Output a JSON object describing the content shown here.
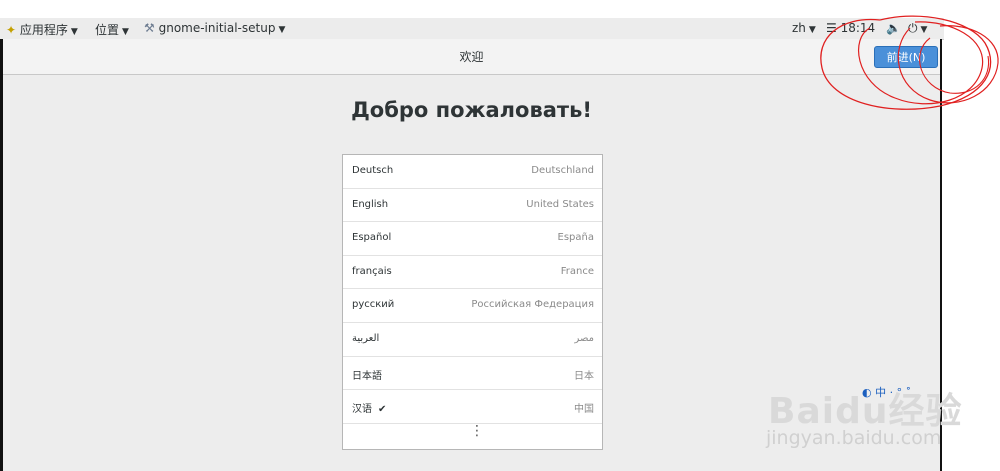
{
  "topbar": {
    "apps_menu": "应用程序",
    "places_menu": "位置",
    "active_app": "gnome-initial-setup",
    "input_method": "zh",
    "clock": "18:14"
  },
  "headerbar": {
    "title": "欢迎",
    "next_button": "前进(N)"
  },
  "main": {
    "heading": "Добро пожаловать!",
    "languages": [
      {
        "name": "Deutsch",
        "region": "Deutschland"
      },
      {
        "name": "English",
        "region": "United States"
      },
      {
        "name": "Español",
        "region": "España"
      },
      {
        "name": "français",
        "region": "France"
      },
      {
        "name": "русский",
        "region": "Российская Федерация"
      },
      {
        "name": "العربية",
        "region": "مصر"
      },
      {
        "name": "日本語",
        "region": "日本"
      },
      {
        "name": "汉语",
        "region": "中国",
        "selected": true
      }
    ],
    "more_icon": "⋮"
  },
  "watermark": {
    "logo": "Baidu经验",
    "url": "jingyan.baidu.com",
    "ime_text": "中"
  },
  "colors": {
    "accent": "#4a90d9",
    "annotation": "#e02020"
  },
  "icons": [
    "apps-icon",
    "settings-app-icon",
    "volume-icon",
    "power-icon",
    "checkmark-icon",
    "more-icon"
  ]
}
